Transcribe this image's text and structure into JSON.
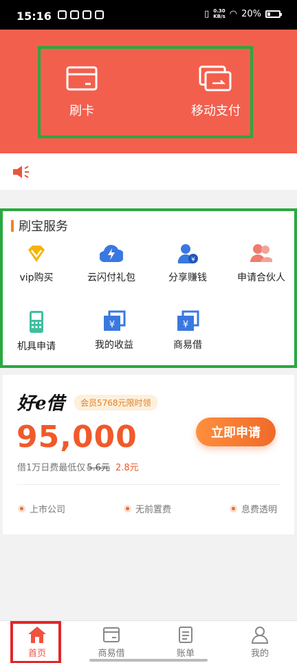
{
  "status_bar": {
    "time": "15:16",
    "speed_value": "0.30",
    "speed_unit": "KB/s",
    "battery": "20%"
  },
  "hero": {
    "swipe_card_label": "刷卡",
    "mobile_pay_label": "移动支付"
  },
  "services": {
    "title": "刷宝服务",
    "items": [
      {
        "label": "vip购买",
        "icon": "diamond-icon"
      },
      {
        "label": "云闪付礼包",
        "icon": "lightning-cloud-icon"
      },
      {
        "label": "分享赚钱",
        "icon": "user-yuan-icon"
      },
      {
        "label": "申请合伙人",
        "icon": "partners-icon"
      },
      {
        "label": "机具申请",
        "icon": "pos-terminal-icon"
      },
      {
        "label": "我的收益",
        "icon": "yuan-card-icon"
      },
      {
        "label": "商易借",
        "icon": "yuan-card-icon"
      }
    ]
  },
  "loan": {
    "brand": "好e借",
    "promo": "会员5768元限时领",
    "amount": "95,000",
    "rate_prefix": "借1万日费最低仅",
    "rate_old": "5.6元",
    "rate_new": "2.8元",
    "apply_label": "立即申请",
    "features": [
      "上市公司",
      "无前置费",
      "息费透明"
    ]
  },
  "tabbar": {
    "items": [
      {
        "label": "首页",
        "icon": "home-icon",
        "active": true
      },
      {
        "label": "商易借",
        "icon": "card-icon",
        "active": false
      },
      {
        "label": "账单",
        "icon": "bill-icon",
        "active": false
      },
      {
        "label": "我的",
        "icon": "profile-icon",
        "active": false
      }
    ]
  },
  "colors": {
    "primary": "#f35f4d",
    "accent": "#f05a2a",
    "highlight_green": "#2aa841",
    "highlight_red": "#e0272a"
  }
}
